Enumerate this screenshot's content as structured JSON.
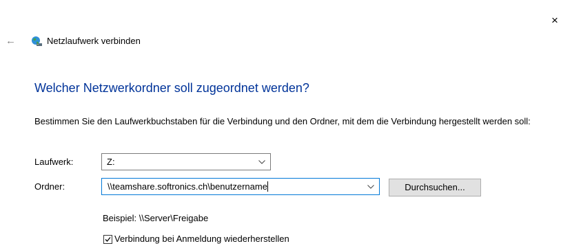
{
  "window": {
    "close_glyph": "×",
    "back_glyph": "←",
    "title": "Netzlaufwerk verbinden",
    "icon": "network-drive-icon"
  },
  "heading": "Welcher Netzwerkordner soll zugeordnet werden?",
  "description": "Bestimmen Sie den Laufwerkbuchstaben für die Verbindung und den Ordner, mit dem die Verbindung hergestellt werden soll:",
  "drive": {
    "label": "Laufwerk:",
    "value": "Z:"
  },
  "folder": {
    "label": "Ordner:",
    "value": "\\\\teamshare.softronics.ch\\benutzername",
    "browse_label": "Durchsuchen...",
    "example": "Beispiel: \\\\Server\\Freigabe"
  },
  "reconnect": {
    "label": "Verbindung bei Anmeldung wiederherstellen",
    "checked": true
  },
  "colors": {
    "heading": "#003399",
    "focus_border": "#0078d7",
    "button_bg": "#e1e1e1"
  }
}
